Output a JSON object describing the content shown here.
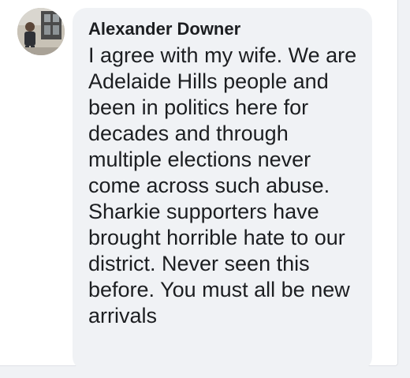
{
  "comment": {
    "author": "Alexander Downer",
    "text": "I agree with my wife. We are Adelaide Hills people and been in politics here for decades and through multiple elections never come across such abuse. Sharkie supporters have brought horrible hate to our district. Never seen this before. You must all be new arrivals"
  },
  "icons": {
    "avatar": "profile-photo"
  }
}
